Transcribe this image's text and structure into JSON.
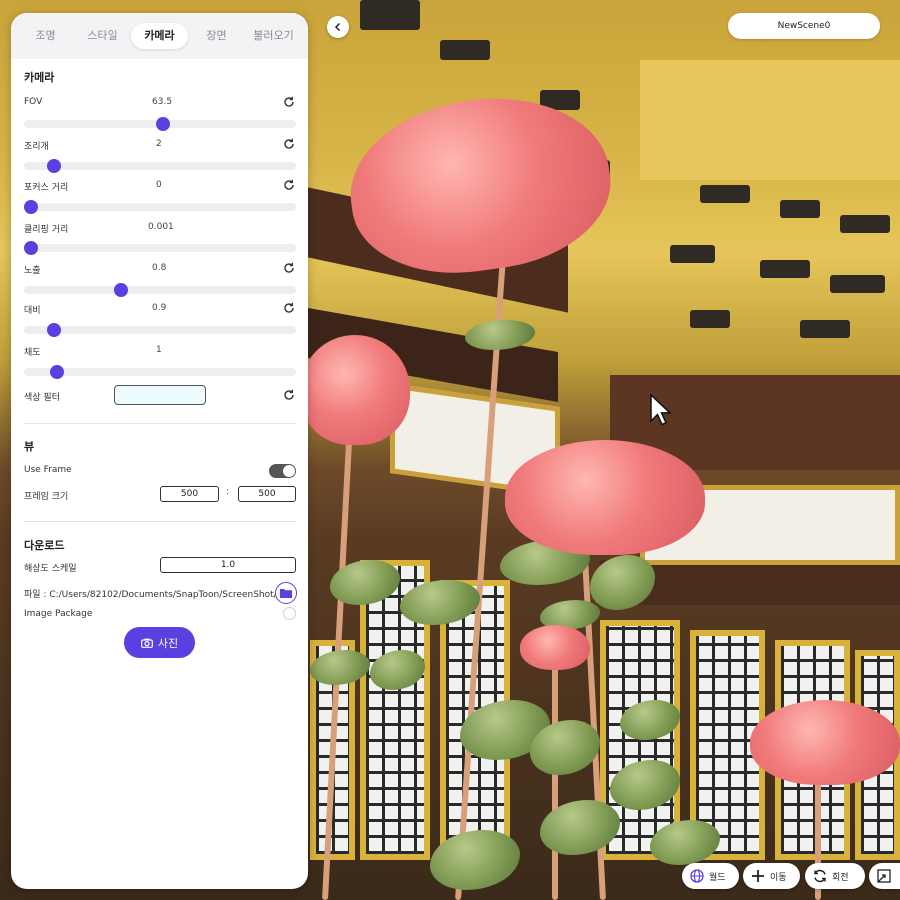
{
  "tabs": [
    {
      "label": "조명"
    },
    {
      "label": "스타일"
    },
    {
      "label": "카메라",
      "active": true
    },
    {
      "label": "장면"
    },
    {
      "label": "불러오기"
    }
  ],
  "camera": {
    "title": "카메라",
    "fov": {
      "label": "FOV",
      "value": "63.5",
      "level": 0.51
    },
    "aperture": {
      "label": "조리개",
      "value": "2",
      "level": 0.09
    },
    "focus": {
      "label": "포커스 거리",
      "value": "0",
      "level": 0.0
    },
    "clipping": {
      "label": "클리핑 거리",
      "value": "0.001",
      "level": 0.0
    },
    "exposure": {
      "label": "노출",
      "value": "0.8",
      "level": 0.35
    },
    "contrast": {
      "label": "대비",
      "value": "0.9",
      "level": 0.09
    },
    "saturation": {
      "label": "채도",
      "value": "1",
      "level": 0.1
    },
    "color_filter": {
      "label": "색상 필터",
      "color": "#eefbff"
    }
  },
  "view": {
    "title": "뷰",
    "use_frame_label": "Use Frame",
    "frame_size_label": "프레임 크기",
    "frame_width": "500",
    "frame_sep": ":",
    "frame_height": "500"
  },
  "download": {
    "title": "다운로드",
    "res_scale_label": "해상도 스케일",
    "res_scale_value": "1.0",
    "file_label": "파일 : C:/Users/82102/Documents/SnapToon/ScreenShot/",
    "image_package_label": "Image Package",
    "photo_button": "사진"
  },
  "scene_name": "NewScene0",
  "tools": [
    {
      "label": "월드",
      "icon": "globe-icon"
    },
    {
      "label": "이동",
      "icon": "move-icon"
    },
    {
      "label": "회전",
      "icon": "rotate-icon"
    }
  ],
  "colors": {
    "accent": "#5b3fe0"
  }
}
